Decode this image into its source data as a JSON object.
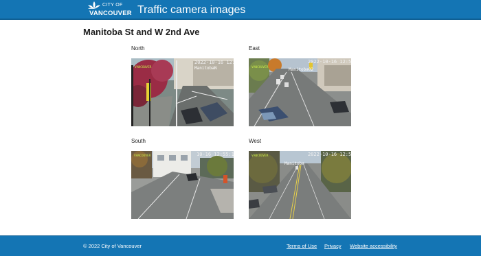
{
  "header": {
    "logo_city_of": "CITY OF",
    "logo_vancouver": "VANCOUVER",
    "site_title": "Traffic camera images"
  },
  "page": {
    "title": "Manitoba St and W 2nd Ave"
  },
  "cameras": [
    {
      "direction": "North",
      "timestamp": "2022-10-16 12:55:22",
      "camera_id": "ManitobaN"
    },
    {
      "direction": "East",
      "timestamp": "2022-10-16 12:55",
      "camera_id": "Manitoba02"
    },
    {
      "direction": "South",
      "timestamp": "10-16 12:55:13",
      "camera_id": ""
    },
    {
      "direction": "West",
      "timestamp": "2022-10-16 12:55",
      "camera_id": "Manitoba"
    }
  ],
  "footer": {
    "copyright": "© 2022 City of Vancouver",
    "links": [
      "Terms of Use",
      "Privacy",
      "Website accessibility"
    ]
  },
  "colors": {
    "brand_blue": "#1475b4"
  }
}
